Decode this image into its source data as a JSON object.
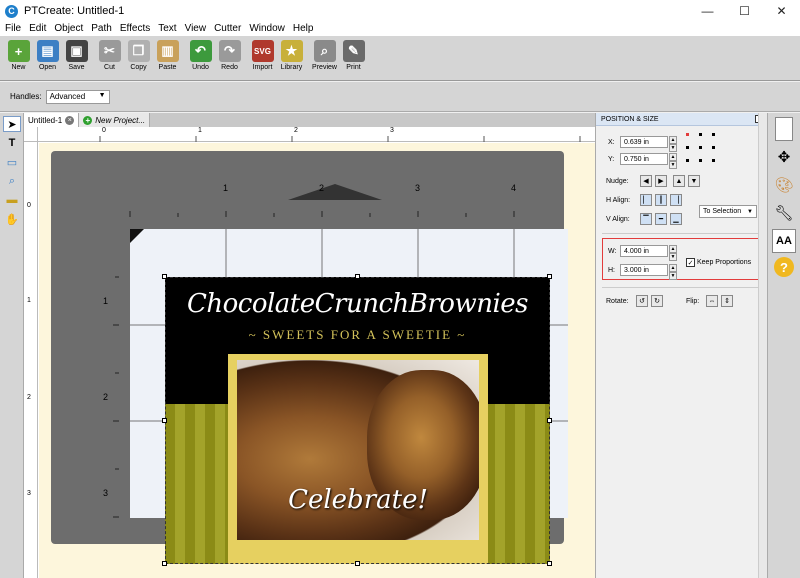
{
  "window": {
    "title": "PTCreate: Untitled-1",
    "app_icon": "C"
  },
  "window_controls": {
    "minimize": "—",
    "maximize": "☐",
    "close": "✕"
  },
  "menu": [
    "File",
    "Edit",
    "Object",
    "Path",
    "Effects",
    "Text",
    "View",
    "Cutter",
    "Window",
    "Help"
  ],
  "toolbar": [
    {
      "label": "New",
      "icon": "new-icon",
      "color": "#5aa43a"
    },
    {
      "label": "Open",
      "icon": "open-icon",
      "color": "#3c7fc4"
    },
    {
      "label": "Save",
      "icon": "save-icon",
      "color": "#444444"
    },
    {
      "label": "Cut",
      "icon": "cut-icon",
      "color": "#9a9a9a"
    },
    {
      "label": "Copy",
      "icon": "copy-icon",
      "color": "#b0b0b0"
    },
    {
      "label": "Paste",
      "icon": "paste-icon",
      "color": "#c9a15a"
    },
    {
      "label": "Undo",
      "icon": "undo-icon",
      "color": "#3d9a3d"
    },
    {
      "label": "Redo",
      "icon": "redo-icon",
      "color": "#9a9a9a"
    },
    {
      "label": "Import",
      "icon": "import-icon",
      "color": "#b0392d"
    },
    {
      "label": "Library",
      "icon": "library-icon",
      "color": "#c8b03a"
    },
    {
      "label": "Preview",
      "icon": "preview-icon",
      "color": "#8a8a8a"
    },
    {
      "label": "Print",
      "icon": "print-icon",
      "color": "#6a6a6a"
    }
  ],
  "options": {
    "handles_label": "Handles:",
    "handles_value": "Advanced"
  },
  "tabs": [
    {
      "label": "Untitled-1",
      "active": true
    },
    {
      "label": "New Project...",
      "active": false
    }
  ],
  "rulers": {
    "top": [
      "0",
      "1",
      "2",
      "3"
    ],
    "left": [
      "0",
      "1",
      "2",
      "3"
    ],
    "mat_top": [
      "1",
      "2",
      "3",
      "4"
    ],
    "mat_left": [
      "1",
      "2",
      "3"
    ]
  },
  "design": {
    "title": "ChocolateCrunchBrownies",
    "subtitle": "~ SWEETS FOR A SWEETIE ~",
    "photo_caption": "Celebrate!"
  },
  "panel": {
    "header": "POSITION & SIZE",
    "x_label": "X:",
    "x_value": "0.639 in",
    "y_label": "Y:",
    "y_value": "0.750 in",
    "nudge_label": "Nudge:",
    "halign_label": "H Align:",
    "valign_label": "V Align:",
    "align_to": "To Selection",
    "w_label": "W:",
    "w_value": "4.000 in",
    "h_label": "H:",
    "h_value": "3.000 in",
    "keep_proportions_label": "Keep Proportions",
    "keep_proportions_checked": true,
    "rotate_label": "Rotate:",
    "flip_label": "Flip:"
  },
  "rail": [
    "page-icon",
    "move-icon",
    "palette-icon",
    "wrench-icon",
    "text-size-icon",
    "help-icon"
  ]
}
